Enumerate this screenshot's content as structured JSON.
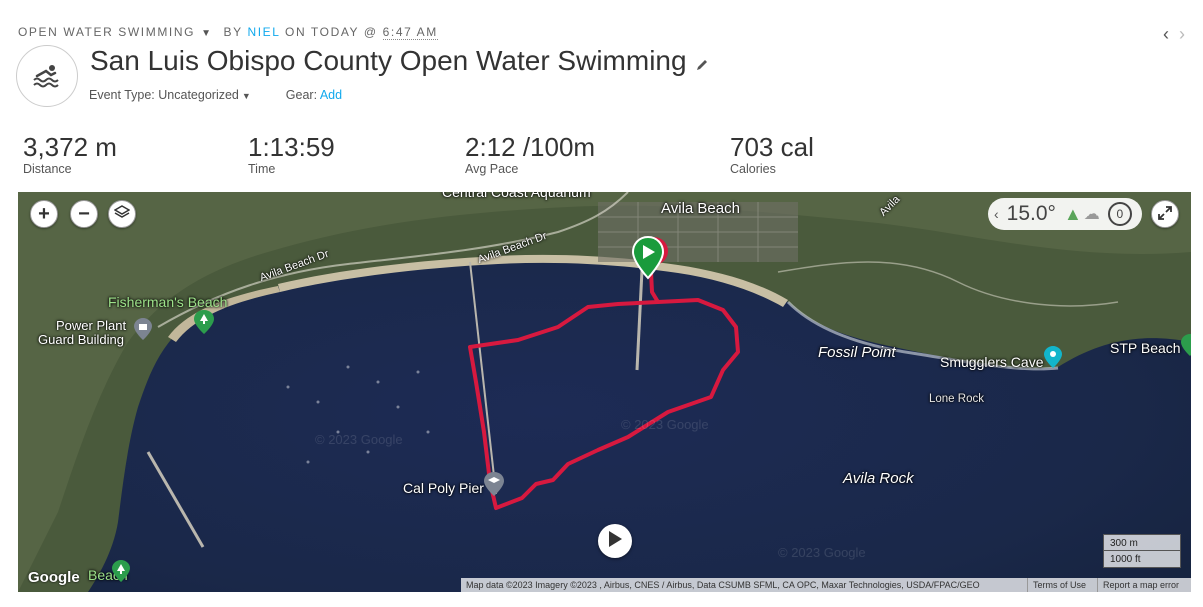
{
  "header": {
    "activity_type": "OPEN WATER SWIMMING",
    "by_label": "BY",
    "user": "NIEL",
    "on_label": "ON TODAY @",
    "time": "6:47 AM",
    "title": "San Luis Obispo County Open Water Swimming",
    "event_type_label": "Event Type:",
    "event_type_value": "Uncategorized",
    "gear_label": "Gear:",
    "gear_value": "Add",
    "activity_icon": "swimmer-icon",
    "edit_icon": "pencil-icon",
    "nav_prev_icon": "chevron-left-icon",
    "nav_next_icon": "chevron-right-icon"
  },
  "stats": [
    {
      "value": "3,372 m",
      "label": "Distance"
    },
    {
      "value": "1:13:59",
      "label": "Time"
    },
    {
      "value": "2:12 /100m",
      "label": "Avg Pace"
    },
    {
      "value": "703 cal",
      "label": "Calories"
    }
  ],
  "map": {
    "controls": {
      "zoom_in": "+",
      "zoom_out": "−",
      "layers_icon": "layers-icon",
      "fullscreen_icon": "fullscreen-icon",
      "play_icon": "play-icon"
    },
    "weather": {
      "temperature": "15.0°",
      "wind": "0",
      "icons": [
        "chevron-left-icon",
        "tree-icon",
        "cloud-icon",
        "wind-icon"
      ]
    },
    "places": {
      "central_coast_aquarium": "Central Coast Aquarium",
      "avila_beach": "Avila Beach",
      "avila_beach_dr_1": "Avila Beach Dr",
      "avila_beach_dr_2": "Avila Beach Dr",
      "avila_top_right": "Avila",
      "fishermans_beach": "Fisherman's Beach",
      "power_plant_1": "Power Plant",
      "power_plant_2": "Guard Building",
      "fossil_point": "Fossil Point",
      "smugglers_cave": "Smugglers Cave",
      "stp_beach": "STP Beach",
      "lone_rock": "Lone Rock",
      "avila_rock": "Avila Rock",
      "cal_poly_pier": "Cal Poly Pier",
      "bottom_left_beach": "Beach"
    },
    "watermark": "© 2023 Google",
    "scale": {
      "metric": "300 m",
      "imperial": "1000 ft"
    },
    "google_logo": "Google",
    "attribution": "Map data ©2023 Imagery ©2023 , Airbus, CNES / Airbus, Data CSUMB SFML, CA OPC, Maxar Technologies, USDA/FPAC/GEO",
    "terms": "Terms of Use",
    "report": "Report a map error",
    "route_color": "#d7193f",
    "start_color": "#1a9b3c"
  }
}
